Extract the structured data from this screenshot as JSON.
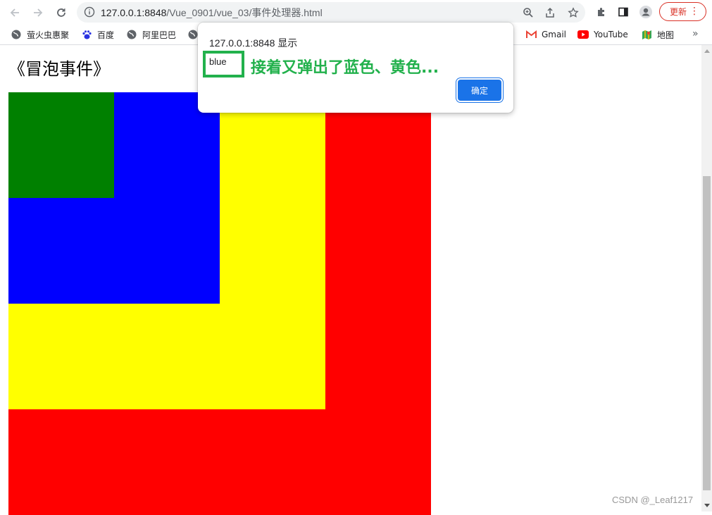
{
  "browser": {
    "url_host": "127.0.0.1:8848",
    "url_path": "/Vue_0901/vue_03/事件处理器.html",
    "update_label": "更新",
    "bookmarks": [
      {
        "label": "萤火虫惠聚",
        "icon": "globe-icon"
      },
      {
        "label": "百度",
        "icon": "baidu-paw-icon"
      },
      {
        "label": "阿里巴巴",
        "icon": "globe-icon"
      },
      {
        "label": "Gmail",
        "icon": "gmail-icon"
      },
      {
        "label": "YouTube",
        "icon": "youtube-icon"
      },
      {
        "label": "地图",
        "icon": "maps-icon"
      }
    ],
    "bookmarks_more": "»"
  },
  "page": {
    "heading": "《冒泡事件》",
    "boxes": [
      {
        "color": "#ff0000",
        "name": "red"
      },
      {
        "color": "#ffff00",
        "name": "yellow"
      },
      {
        "color": "#0000ff",
        "name": "blue"
      },
      {
        "color": "#008000",
        "name": "green"
      }
    ]
  },
  "dialog": {
    "title": "127.0.0.1:8848 显示",
    "message": "blue",
    "ok_label": "确定"
  },
  "annotation": {
    "text": "接着又弹出了蓝色、黄色...",
    "color": "#22b14c"
  },
  "watermark": "CSDN @_Leaf1217"
}
